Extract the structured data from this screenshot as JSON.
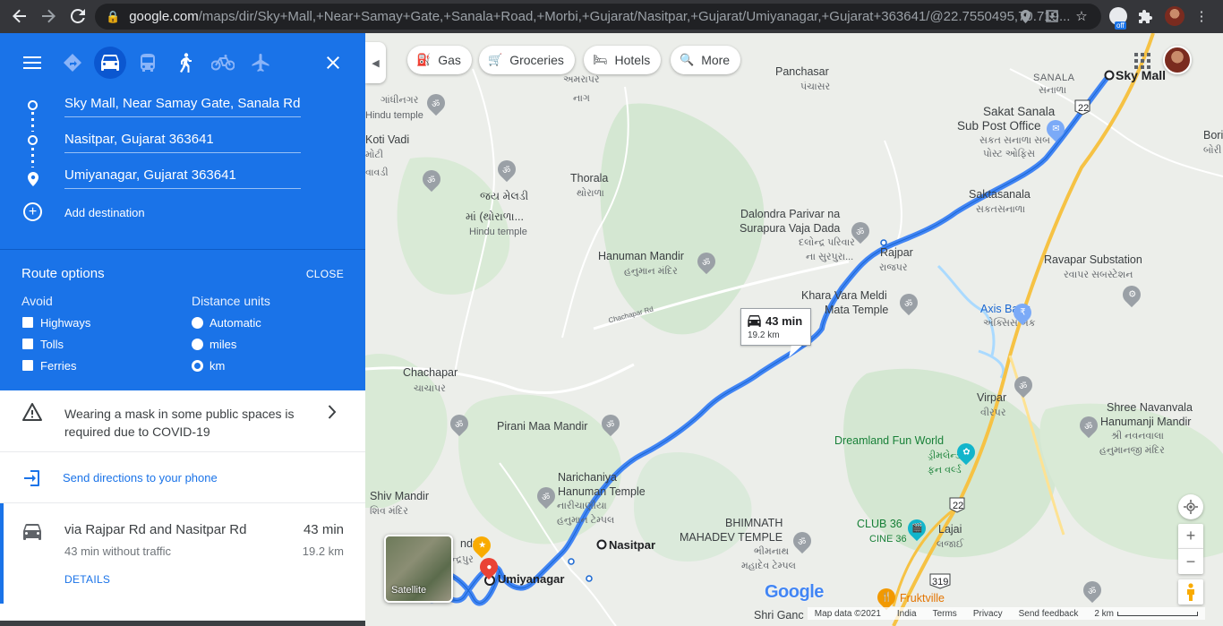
{
  "browser": {
    "url_host": "google.com",
    "url_rest": "/maps/dir/Sky+Mall,+Near+Samay+Gate,+Sanala+Road,+Morbi,+Gujarat/Nasitpar,+Gujarat/Umiyanagar,+Gujarat+363641/@22.7550495,70.719...",
    "ext_badge": "off"
  },
  "directions": {
    "waypoints": [
      {
        "value": "Sky Mall, Near Samay Gate, Sanala Rd, Morbi"
      },
      {
        "value": "Nasitpar, Gujarat 363641"
      },
      {
        "value": "Umiyanagar, Gujarat 363641"
      }
    ],
    "add_destination": "Add destination"
  },
  "route_options": {
    "title": "Route options",
    "close": "CLOSE",
    "avoid_heading": "Avoid",
    "avoid": [
      "Highways",
      "Tolls",
      "Ferries"
    ],
    "units_heading": "Distance units",
    "units": [
      "Automatic",
      "miles",
      "km"
    ],
    "units_selected": "km"
  },
  "notice": {
    "line1": "Wearing a mask in some public spaces is",
    "line2": "required due to COVID-19"
  },
  "send": {
    "label": "Send directions to your phone"
  },
  "route": {
    "via": "via Rajpar Rd and Nasitpar Rd",
    "time": "43 min",
    "traffic": "43 min without traffic",
    "distance": "19.2 km",
    "details": "DETAILS"
  },
  "map": {
    "chips": [
      "Gas",
      "Groceries",
      "Hotels",
      "More"
    ],
    "callout": {
      "time": "43 min",
      "distance": "19.2 km"
    },
    "satellite": "Satellite",
    "brand": "Google",
    "attribution": [
      "Map data ©2021",
      "India",
      "Terms",
      "Privacy",
      "Send feedback",
      "2 km"
    ],
    "road_label": "Chachapar Rd",
    "highway_shields": [
      "22",
      "22",
      "319"
    ],
    "labels": {
      "sky_mall": "Sky Mall",
      "sanala": "SANALA",
      "sanala_g": "સનાળા",
      "panchasar": "Panchasar",
      "panchasar_g": "પંચાસર",
      "sakat": "Sakat Sanala",
      "subpost": "Sub Post Office",
      "sakat_g1": "સકત સનાળા સબ",
      "sakat_g2": "પોસ્ટ ઓફિસ",
      "saktasanala": "Saktasanala",
      "saktasanala_g": "સકતસનાળા",
      "bori": "Bori",
      "bori_g": "બોરી",
      "gandhinagar_g": "ગાંધીનગર",
      "hindu_temple": "Hindu temple",
      "koti_vadi": "Koti Vadi",
      "koti_g": "મોટી",
      "vavdi_g": "વાવડી",
      "thorala": "Thorala",
      "thorala_g": "થોરાળા",
      "jay_meldi_g": "જય મેલડી",
      "jay_meldi_g2": "માં (થોરાળા...",
      "hindu_temple2": "Hindu temple",
      "amrapar_g": "અમરાપર",
      "naga_g": "નાગ",
      "dalondra1": "Dalondra Parivar na",
      "dalondra2": "Surapura Vaja Dada",
      "dalondra_g1": "દલોન્દ્ર પરિવાર",
      "dalondra_g2": "ના સુરપુરા...",
      "hanuman": "Hanuman Mandir",
      "hanuman_g": "હનુમાન મંદિર",
      "rajpar": "Rajpar",
      "rajpar_g": "રાજપર",
      "khara1": "Khara Vara Meldi",
      "khara2": "Mata Temple",
      "ravapar": "Ravapar Substation",
      "ravapar_g": "રવાપર સબસ્ટેશન",
      "axis": "Axis Bank",
      "axis_g": "એક્સિસ બેંક",
      "chachapar": "Chachapar",
      "chachapar_g": "ચાચાપર",
      "virpar": "Virpar",
      "virpar_g": "વીરપર",
      "shree1": "Shree Navanvala",
      "shree2": "Hanumanji Mandir",
      "shree_g1": "શ્રી નવનવાલા",
      "shree_g2": "હનુમાનજી મંદિર",
      "pirani": "Pirani Maa Mandir",
      "dreamland": "Dreamland Fun World",
      "dreamland_g1": "ડ્રીમલેન્ડ",
      "dreamland_g2": "ફન વર્લ્ડ",
      "narichaniya1": "Narichaniya",
      "narichaniya2": "Hanuman Temple",
      "narichaniya_g1": "નારીચાણીયા",
      "narichaniya_g2": "હનુમાન ટેમ્પલ",
      "shiv": "Shiv Mandir",
      "shiv_g": "શિવ મંદિર",
      "nasitpar": "Nasitpar",
      "bhimnath1": "BHIMNATH",
      "bhimnath2": "MAHADEV TEMPLE",
      "bhimnath_g1": "ભીમનાથ",
      "bhimnath_g2": "મહાદેવ ટેમ્પલ",
      "club": "CLUB 36",
      "club_g": "CINE 36",
      "lajai": "Lajai",
      "lajai_g": "લજાઈ",
      "umiyanagar": "Umiyanagar",
      "fruktville": "Fruktville",
      "shri_ganc": "Shri Ganc",
      "chandrapur": "ન્દ્રપુર",
      "ndrar": "ndrar"
    }
  }
}
